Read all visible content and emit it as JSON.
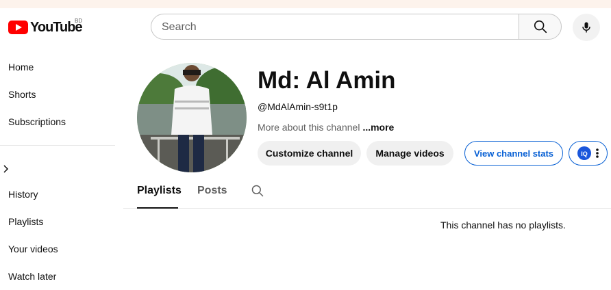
{
  "header": {
    "logo_text": "YouTube",
    "country_code": "BD",
    "search_placeholder": "Search"
  },
  "sidebar": {
    "items": [
      {
        "label": "Home"
      },
      {
        "label": "Shorts"
      },
      {
        "label": "Subscriptions"
      },
      {
        "label": "History"
      },
      {
        "label": "Playlists"
      },
      {
        "label": "Your videos"
      },
      {
        "label": "Watch later"
      }
    ],
    "expand_icon": "chevron-right-icon"
  },
  "channel": {
    "name": "Md: Al Amin",
    "handle": "@MdAlAmin-s9t1p",
    "about": "More about this channel",
    "more": "...more",
    "buttons": {
      "customize": "Customize channel",
      "manage": "Manage videos",
      "stats": "View channel stats"
    }
  },
  "tabs": [
    {
      "label": "Playlists",
      "active": true
    },
    {
      "label": "Posts",
      "active": false
    }
  ],
  "content": {
    "empty_message": "This channel has no playlists."
  },
  "colors": {
    "brand_red": "#ff0000",
    "link_blue": "#065fd4"
  }
}
